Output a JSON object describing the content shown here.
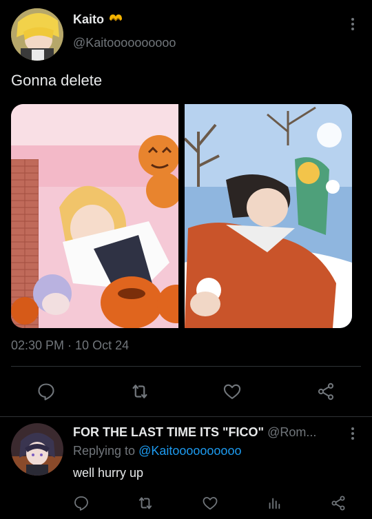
{
  "tweet": {
    "display_name": "Kaito",
    "name_emoji": "heart-hands-icon",
    "handle": "@Kaitoooooooooo",
    "text": "Gonna delete",
    "timestamp": "02:30 PM · 10 Oct 24",
    "actions": [
      "reply-icon",
      "retweet-icon",
      "like-icon",
      "share-icon"
    ]
  },
  "reply": {
    "display_name": "FOR THE LAST TIME ITS \"FICO\"",
    "handle": "@Rom...",
    "replying_prefix": "Replying to ",
    "replying_to": "@Kaitoooooooooo",
    "text": "well hurry up",
    "actions": [
      "reply-icon",
      "retweet-icon",
      "like-icon",
      "views-icon",
      "share-icon"
    ]
  },
  "colors": {
    "background": "#000000",
    "text": "#e7e9ea",
    "secondary": "#71767b",
    "link": "#1d9bf0",
    "divider": "#2f3336",
    "emoji": "#f5b400"
  }
}
